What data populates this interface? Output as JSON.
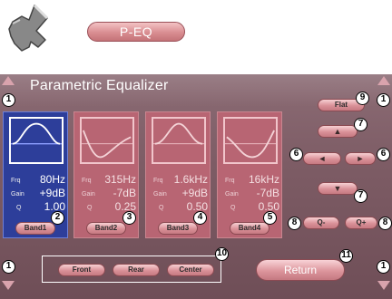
{
  "top": {
    "mode_label": "P-EQ"
  },
  "screen": {
    "title": "Parametric Equalizer",
    "bands": [
      {
        "freq_label": "Frq",
        "freq": "80Hz",
        "gain_label": "Gain",
        "gain": "+9dB",
        "q_label": "Q",
        "q": "1.00",
        "button": "Band1",
        "selected": true,
        "callout": "2"
      },
      {
        "freq_label": "Frq",
        "freq": "315Hz",
        "gain_label": "Gain",
        "gain": "-7dB",
        "q_label": "Q",
        "q": "0.25",
        "button": "Band2",
        "selected": false,
        "callout": "3"
      },
      {
        "freq_label": "Frq",
        "freq": "1.6kHz",
        "gain_label": "Gain",
        "gain": "+9dB",
        "q_label": "Q",
        "q": "0.50",
        "button": "Band3",
        "selected": false,
        "callout": "4"
      },
      {
        "freq_label": "Frq",
        "freq": "16kHz",
        "gain_label": "Gain",
        "gain": "-7dB",
        "q_label": "Q",
        "q": "0.50",
        "button": "Band4",
        "selected": false,
        "callout": "5"
      }
    ],
    "controls": {
      "flat": "Flat",
      "up": "▲",
      "left": "◄",
      "right": "►",
      "down": "▼",
      "q_minus": "Q-",
      "q_plus": "Q+"
    },
    "speakers": {
      "front": "Front",
      "rear": "Rear",
      "center": "Center"
    },
    "return": "Return"
  },
  "callouts": {
    "scroll": "1",
    "flat": "9",
    "up": "7",
    "left": "6",
    "right": "6",
    "down": "7",
    "q_minus": "8",
    "q_plus": "8",
    "speakers": "10",
    "return": "11"
  },
  "colors": {
    "screen_bg": "#7d5c65",
    "selected_band": "#2d3e9a",
    "unselected_band": "#b86573",
    "button": "#da9198"
  },
  "icons": {
    "pointer": "hand-pointer-icon",
    "scroll_up": "triangle-up-icon",
    "scroll_down": "triangle-down-icon"
  }
}
